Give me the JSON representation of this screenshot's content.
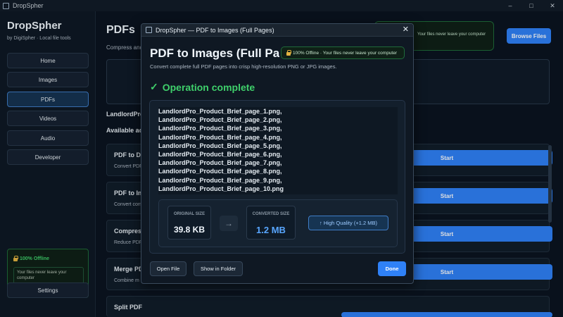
{
  "window": {
    "title": "DropSpher",
    "controls": [
      "–",
      "□",
      "✕"
    ]
  },
  "sidebar": {
    "brand": "DropSpher",
    "tagline": "by DigiSpher · Local file tools",
    "nav": [
      "Home",
      "Images",
      "PDFs",
      "Videos",
      "Audio",
      "Developer"
    ],
    "active": "PDFs",
    "offline": {
      "title": "100% Offline",
      "text": "Your files never leave your computer"
    },
    "settings": "Settings"
  },
  "main": {
    "title": "PDFs",
    "subtitle": "Compress and",
    "badge_text": "Your files never leave your computer",
    "browse": "Browse Files",
    "file_label": "LandlordPro",
    "available": "Available ac",
    "tools": [
      {
        "name": "PDF to DO",
        "desc": "Convert PDF",
        "action": "Start"
      },
      {
        "name": "PDF to Im",
        "desc": "Convert com",
        "action": "Start"
      },
      {
        "name": "Compress",
        "desc": "Reduce PDF",
        "action": "Start"
      },
      {
        "name": "Merge PD",
        "desc": "Combine m",
        "action": "Start"
      },
      {
        "name": "Split PDF",
        "desc": "",
        "action": ""
      }
    ]
  },
  "dialog": {
    "title": "DropSpher — PDF to Images (Full Pages)",
    "close": "✕",
    "heading": "PDF to Images (Full Pag",
    "badge": "100% Offline · Your files never leave your computer",
    "subtitle": "Convert complete full PDF pages into crisp high-resolution PNG or JPG images.",
    "status": "Operation complete",
    "status_mark": "✓",
    "files": [
      "LandlordPro_Product_Brief_page_1.png,",
      "LandlordPro_Product_Brief_page_2.png,",
      "LandlordPro_Product_Brief_page_3.png,",
      "LandlordPro_Product_Brief_page_4.png,",
      "LandlordPro_Product_Brief_page_5.png,",
      "LandlordPro_Product_Brief_page_6.png,",
      "LandlordPro_Product_Brief_page_7.png,",
      "LandlordPro_Product_Brief_page_8.png,",
      "LandlordPro_Product_Brief_page_9.png,",
      "LandlordPro_Product_Brief_page_10.png"
    ],
    "original_label": "ORIGINAL SIZE",
    "original_value": "39.8 KB",
    "converted_label": "CONVERTED SIZE",
    "converted_value": "1.2 MB",
    "quality": "↑ High Quality (+1.2 MB)",
    "open_file": "Open File",
    "show_in_folder": "Show in Folder",
    "done": "Done"
  },
  "colors": {
    "accent": "#2f81f7",
    "success": "#3fd06b",
    "converted": "#58a6ff"
  }
}
